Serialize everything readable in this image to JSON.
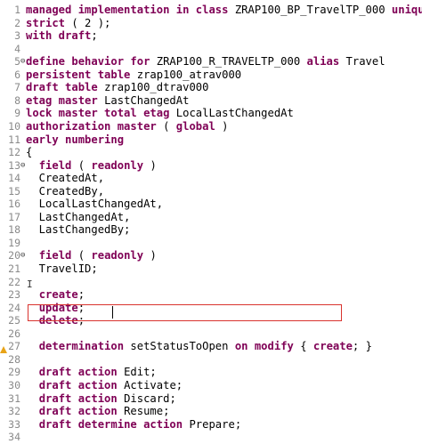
{
  "editor": {
    "lines": [
      {
        "no": "1",
        "segs": [
          [
            "kw",
            "managed implementation in class "
          ],
          [
            "id",
            "ZRAP100_BP_TravelTP_000 "
          ],
          [
            "kw",
            "unique"
          ],
          [
            "id",
            ";"
          ]
        ]
      },
      {
        "no": "2",
        "segs": [
          [
            "kw",
            "strict"
          ],
          [
            "id",
            " ( 2 );"
          ]
        ]
      },
      {
        "no": "3",
        "segs": [
          [
            "kw",
            "with draft"
          ],
          [
            "id",
            ";"
          ]
        ]
      },
      {
        "no": "4",
        "segs": []
      },
      {
        "no": "5",
        "fold": "⊖",
        "segs": [
          [
            "kw",
            "define behavior for "
          ],
          [
            "id",
            "ZRAP100_R_TRAVELTP_000 "
          ],
          [
            "kw",
            "alias "
          ],
          [
            "id",
            "Travel"
          ]
        ]
      },
      {
        "no": "6",
        "segs": [
          [
            "kw",
            "persistent table "
          ],
          [
            "id",
            "zrap100_atrav000"
          ]
        ]
      },
      {
        "no": "7",
        "segs": [
          [
            "kw",
            "draft table "
          ],
          [
            "id",
            "zrap100_dtrav000"
          ]
        ]
      },
      {
        "no": "8",
        "segs": [
          [
            "kw",
            "etag master "
          ],
          [
            "id",
            "LastChangedAt"
          ]
        ]
      },
      {
        "no": "9",
        "segs": [
          [
            "kw",
            "lock master total etag "
          ],
          [
            "id",
            "LocalLastChangedAt"
          ]
        ]
      },
      {
        "no": "10",
        "segs": [
          [
            "kw",
            "authorization master "
          ],
          [
            "id",
            "( "
          ],
          [
            "kw",
            "global "
          ],
          [
            "id",
            ")"
          ]
        ]
      },
      {
        "no": "11",
        "segs": [
          [
            "kw",
            "early numbering"
          ]
        ]
      },
      {
        "no": "12",
        "segs": [
          [
            "id",
            "{"
          ]
        ]
      },
      {
        "no": "13",
        "fold": "⊖",
        "segs": [
          [
            "id",
            "  "
          ],
          [
            "kw",
            "field "
          ],
          [
            "id",
            "( "
          ],
          [
            "kw",
            "readonly "
          ],
          [
            "id",
            ")"
          ]
        ]
      },
      {
        "no": "14",
        "segs": [
          [
            "id",
            "  CreatedAt,"
          ]
        ]
      },
      {
        "no": "15",
        "segs": [
          [
            "id",
            "  CreatedBy,"
          ]
        ]
      },
      {
        "no": "16",
        "segs": [
          [
            "id",
            "  LocalLastChangedAt,"
          ]
        ]
      },
      {
        "no": "17",
        "segs": [
          [
            "id",
            "  LastChangedAt,"
          ]
        ]
      },
      {
        "no": "18",
        "segs": [
          [
            "id",
            "  LastChangedBy;"
          ]
        ]
      },
      {
        "no": "19",
        "segs": []
      },
      {
        "no": "20",
        "fold": "⊖",
        "segs": [
          [
            "id",
            "  "
          ],
          [
            "kw",
            "field "
          ],
          [
            "id",
            "( "
          ],
          [
            "kw",
            "readonly "
          ],
          [
            "id",
            ")"
          ]
        ]
      },
      {
        "no": "21",
        "segs": [
          [
            "id",
            "  TravelID;"
          ]
        ]
      },
      {
        "no": "22",
        "segs": []
      },
      {
        "no": "23",
        "segs": [
          [
            "id",
            "  "
          ],
          [
            "kw",
            "create"
          ],
          [
            "id",
            ";"
          ]
        ]
      },
      {
        "no": "24",
        "segs": [
          [
            "id",
            "  "
          ],
          [
            "kw",
            "update"
          ],
          [
            "id",
            ";"
          ]
        ]
      },
      {
        "no": "25",
        "segs": [
          [
            "id",
            "  "
          ],
          [
            "kw",
            "delete"
          ],
          [
            "id",
            ";"
          ]
        ]
      },
      {
        "no": "26",
        "segs": []
      },
      {
        "no": "27",
        "warn": true,
        "segs": [
          [
            "id",
            "  "
          ],
          [
            "kw",
            "determination "
          ],
          [
            "id",
            "setStatusToOpen "
          ],
          [
            "kw",
            "on modify "
          ],
          [
            "id",
            "{ "
          ],
          [
            "kw",
            "create"
          ],
          [
            "id",
            "; }"
          ]
        ]
      },
      {
        "no": "28",
        "segs": []
      },
      {
        "no": "29",
        "segs": [
          [
            "id",
            "  "
          ],
          [
            "kw",
            "draft action "
          ],
          [
            "id",
            "Edit;"
          ]
        ]
      },
      {
        "no": "30",
        "segs": [
          [
            "id",
            "  "
          ],
          [
            "kw",
            "draft action "
          ],
          [
            "id",
            "Activate;"
          ]
        ]
      },
      {
        "no": "31",
        "segs": [
          [
            "id",
            "  "
          ],
          [
            "kw",
            "draft action "
          ],
          [
            "id",
            "Discard;"
          ]
        ]
      },
      {
        "no": "32",
        "segs": [
          [
            "id",
            "  "
          ],
          [
            "kw",
            "draft action "
          ],
          [
            "id",
            "Resume;"
          ]
        ]
      },
      {
        "no": "33",
        "segs": [
          [
            "id",
            "  "
          ],
          [
            "kw",
            "draft determine action "
          ],
          [
            "id",
            "Prepare;"
          ]
        ]
      },
      {
        "no": "34",
        "segs": []
      }
    ],
    "colors": {
      "keyword": "#7f0055",
      "identifier": "#000000",
      "line_number": "#8a8a8a",
      "highlight_border": "#d9332e",
      "warning": "#e8a317"
    },
    "icons": {
      "fold": "collapse-icon",
      "warning": "warning-icon",
      "cursor": "ibeam-cursor-icon"
    }
  }
}
